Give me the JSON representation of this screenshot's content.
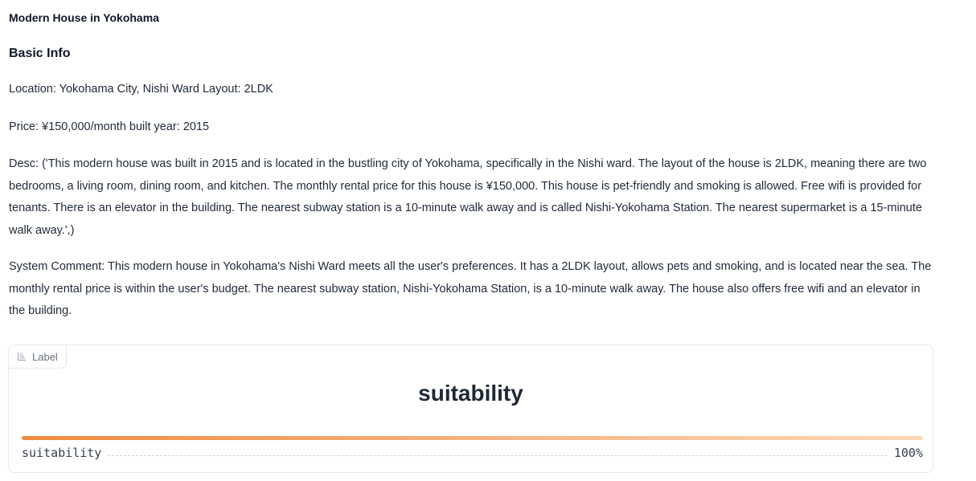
{
  "page": {
    "title": "Modern House in Yokohama",
    "section_heading": "Basic Info",
    "location_line": "Location: Yokohama City, Nishi Ward Layout: 2LDK",
    "price_line": "Price: ¥150,000/month built year: 2015",
    "desc": "Desc: ('This modern house was built in 2015 and is located in the bustling city of Yokohama, specifically in the Nishi ward. The layout of the house is 2LDK, meaning there are two bedrooms, a living room, dining room, and kitchen. The monthly rental price for this house is ¥150,000. This house is pet-friendly and smoking is allowed. Free wifi is provided for tenants. There is an elevator in the building. The nearest subway station is a 10-minute walk away and is called Nishi-Yokohama Station. The nearest supermarket is a 15-minute walk away.',)",
    "system_comment": "System Comment: This modern house in Yokohama's Nishi Ward meets all the user's preferences. It has a 2LDK layout, allows pets and smoking, and is located near the sea. The monthly rental price is within the user's budget. The nearest subway station, Nishi-Yokohama Station, is a 10-minute walk away. The house also offers free wifi and an elevator in the building."
  },
  "label_component": {
    "tag_label": "Label",
    "tag_icon": "label-icon",
    "predicted_label": "suitability",
    "confidences": [
      {
        "label": "suitability",
        "value_text": "100%",
        "fraction": 1.0
      }
    ],
    "accent_color": "#f08a3c"
  }
}
